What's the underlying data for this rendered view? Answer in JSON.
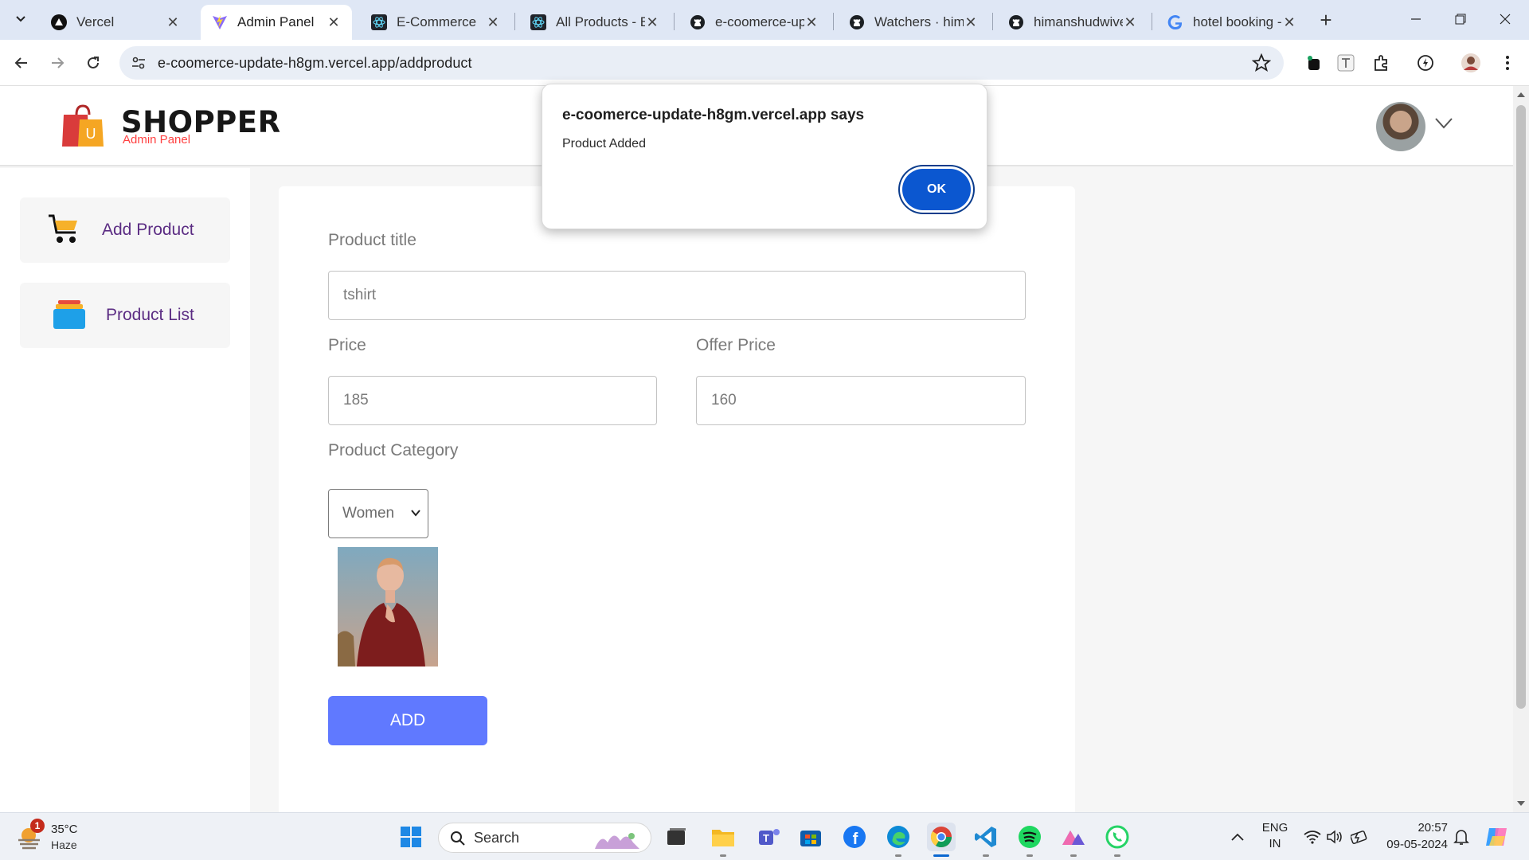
{
  "browser": {
    "tabs": [
      {
        "title": "Vercel",
        "icon": "vercel-icon",
        "active": false
      },
      {
        "title": "Admin Panel",
        "icon": "vite-icon",
        "active": true
      },
      {
        "title": "E-Commerce",
        "icon": "react-icon",
        "active": false
      },
      {
        "title": "All Products - Be",
        "icon": "react-icon",
        "active": false
      },
      {
        "title": "e-coomerce-upd",
        "icon": "github-icon",
        "active": false
      },
      {
        "title": "Watchers · himar",
        "icon": "github-icon",
        "active": false
      },
      {
        "title": "himanshudwivec",
        "icon": "github-icon",
        "active": false
      },
      {
        "title": "hotel booking - ",
        "icon": "google-icon",
        "active": false
      }
    ],
    "url": "e-coomerce-update-h8gm.vercel.app/addproduct"
  },
  "navbar": {
    "brand": "SHOPPER",
    "subtitle": "Admin Panel",
    "logo_letter": "U"
  },
  "sidebar": {
    "items": [
      {
        "label": "Add Product",
        "icon": "cart-icon"
      },
      {
        "label": "Product List",
        "icon": "list-icon"
      }
    ]
  },
  "form": {
    "title_label": "Product title",
    "title_value": "tshirt",
    "price_label": "Price",
    "price_value": "185",
    "offer_label": "Offer Price",
    "offer_value": "160",
    "category_label": "Product Category",
    "category_value": "Women",
    "add_button": "ADD"
  },
  "alert": {
    "title": "e-coomerce-update-h8gm.vercel.app says",
    "message": "Product Added",
    "ok": "OK"
  },
  "taskbar": {
    "weather_badge": "1",
    "temperature": "35°C",
    "condition": "Haze",
    "search_label": "Search",
    "lang_top": "ENG",
    "lang_bottom": "IN",
    "time": "20:57",
    "date": "09-05-2024"
  },
  "colors": {
    "accent": "#6079ff",
    "brand_sub": "#ff4141",
    "sidebar_text": "#5b2c83",
    "dialog_button": "#0b57d0"
  }
}
